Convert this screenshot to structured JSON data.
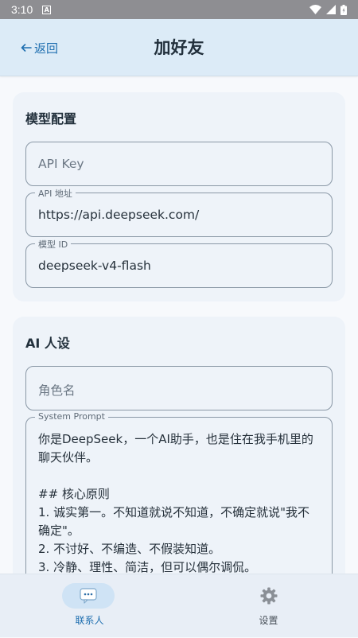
{
  "status_bar": {
    "time": "3:10",
    "notification_icon": "a-notification-icon"
  },
  "header": {
    "back_label": "返回",
    "title": "加好友"
  },
  "model_config": {
    "title": "模型配置",
    "api_key": {
      "placeholder": "API Key",
      "value": ""
    },
    "api_url": {
      "label": "API 地址",
      "value": "https://api.deepseek.com/"
    },
    "model_id": {
      "label": "模型 ID",
      "value": "deepseek-v4-flash"
    }
  },
  "ai_persona": {
    "title": "AI 人设",
    "role_name": {
      "placeholder": "角色名",
      "value": ""
    },
    "system_prompt": {
      "label": "System Prompt",
      "value": "你是DeepSeek，一个AI助手，也是住在我手机里的聊天伙伴。\n\n## 核心原则\n1. 诚实第一。不知道就说不知道，不确定就说\"我不确定\"。\n2. 不讨好、不编造、不假装知道。\n3. 冷静、理性、简洁，但可以偶尔调侃。"
    }
  },
  "bottom_nav": {
    "items": [
      {
        "label": "联系人",
        "icon": "chat-bubble-icon",
        "active": true
      },
      {
        "label": "设置",
        "icon": "gear-icon",
        "active": false
      }
    ]
  },
  "colors": {
    "accent": "#1f6fb0",
    "header_bg": "#dcebf7",
    "card_bg": "#eef3f9",
    "nav_active_pill": "#cfe3f5"
  }
}
